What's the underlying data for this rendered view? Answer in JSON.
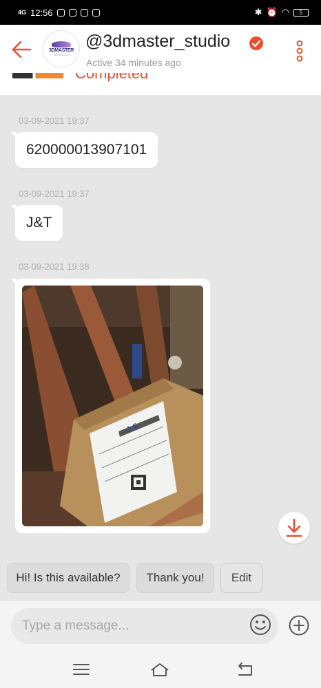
{
  "status_bar": {
    "network": "4G",
    "time": "12:56",
    "battery": "5",
    "icons": [
      "facebook-messenger-icon",
      "facebook-icon",
      "app-icon",
      "gallery-icon",
      "bluetooth-icon",
      "alarm-icon",
      "wifi-icon",
      "battery-icon"
    ]
  },
  "header": {
    "shop_name": "@3dmaster_studio",
    "active_status": "Active 34 minutes ago",
    "avatar_text": "3DMASTER",
    "avatar_subtext": "STUDIO"
  },
  "order_strip": {
    "status": "Completed"
  },
  "messages": [
    {
      "timestamp": "03-09-2021 19:37",
      "type": "text",
      "text": "620000013907101"
    },
    {
      "timestamp": "03-09-2021 19:37",
      "type": "text",
      "text": "J&T"
    },
    {
      "timestamp": "03-09-2021 19:38",
      "type": "image",
      "image_description": "parcel-photo"
    }
  ],
  "quick_replies": [
    {
      "label": "Hi! Is this available?"
    },
    {
      "label": "Thank you!"
    },
    {
      "label": "Edit"
    }
  ],
  "composer": {
    "placeholder": "Type a message...",
    "value": ""
  },
  "colors": {
    "accent": "#ee4d2d",
    "background": "#e6e6e6"
  }
}
